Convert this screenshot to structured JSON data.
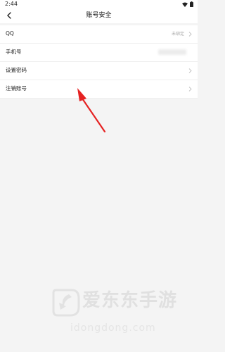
{
  "status_bar": {
    "time": "2:44"
  },
  "nav": {
    "title": "账号安全"
  },
  "rows": [
    {
      "label": "QQ",
      "value": "未绑定"
    },
    {
      "label": "手机号"
    },
    {
      "label": "设置密码"
    },
    {
      "label": "注销账号"
    }
  ],
  "watermark": {
    "title": "爱东东手游",
    "url": "idongdong.com"
  },
  "annotation": {
    "color": "#e52222"
  }
}
